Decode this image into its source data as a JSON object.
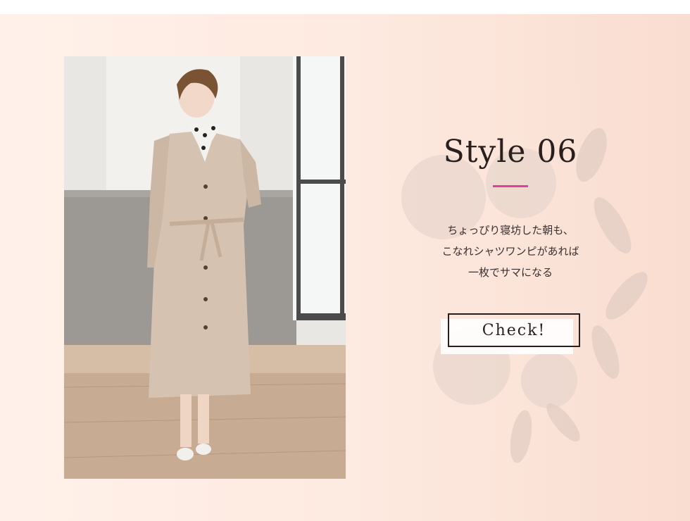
{
  "style_section": {
    "title": "Style 06",
    "description_lines": [
      "ちょっぴり寝坊した朝も、",
      "こなれシャツワンピがあれば",
      "一枚でサマになる"
    ],
    "check_button_label": "Check!",
    "accent_color": "#e0409a",
    "background_color": "#fde9df"
  }
}
